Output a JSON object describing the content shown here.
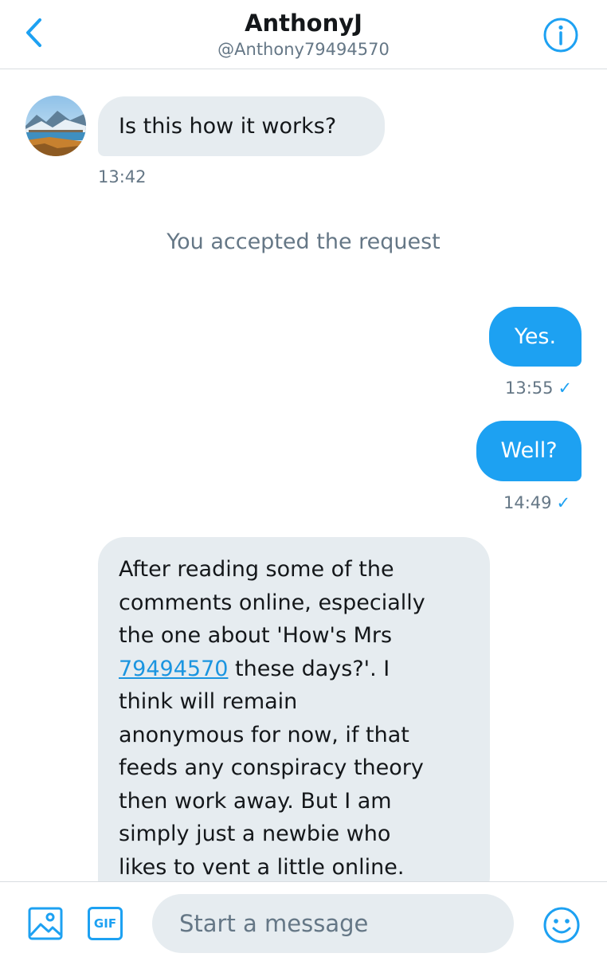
{
  "header": {
    "title": "AnthonyJ",
    "handle": "@Anthony79494570",
    "back_icon": "chevron-left-icon",
    "info_icon": "info-icon"
  },
  "conversation": {
    "first_message": {
      "text": "Is this how it works?",
      "time": "13:42"
    },
    "system_note": "You accepted the request",
    "sent": [
      {
        "text": "Yes.",
        "time": "13:55",
        "read_mark": "✓"
      },
      {
        "text": "Well?",
        "time": "14:49",
        "read_mark": "✓"
      }
    ],
    "long_message": {
      "line1": "After reading some of the",
      "line2": "comments online, especially",
      "line3": "the one about 'How's Mrs",
      "link": "79494570",
      "line4_rest": " these days?'. I",
      "line5": "think will remain",
      "line6": "anonymous for now, if that",
      "line7": "feeds any conspiracy theory",
      "line8": "then work away. But I am",
      "line9": "simply just a newbie who",
      "line10": "likes to vent a little online."
    }
  },
  "composer": {
    "placeholder": "Start a message",
    "gif_label": "GIF",
    "image_icon": "image-icon",
    "emoji_icon": "emoji-icon"
  },
  "colors": {
    "accent": "#1da1f2",
    "incoming_bubble": "#e6ecf0",
    "secondary_text": "#657786"
  }
}
